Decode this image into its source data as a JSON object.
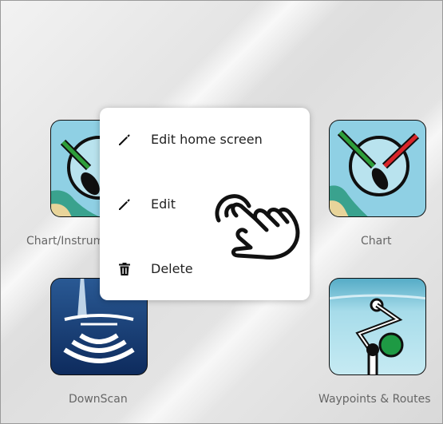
{
  "apps": [
    {
      "label": "Chart/Instruments",
      "icon": "chart-instruments-icon"
    },
    {
      "label": "Chart",
      "icon": "chart-icon"
    },
    {
      "label": "DownScan",
      "icon": "downscan-icon"
    },
    {
      "label": "Waypoints & Routes",
      "icon": "waypoints-routes-icon"
    }
  ],
  "context_menu": {
    "items": [
      {
        "label": "Edit home screen",
        "icon": "pencil-icon"
      },
      {
        "label": "Edit",
        "icon": "pencil-icon"
      },
      {
        "label": "Delete",
        "icon": "trash-icon"
      }
    ]
  },
  "overlay": {
    "icon": "tap-gesture-hand-icon"
  },
  "colors": {
    "tile_border": "#111111",
    "sea_light": "#9ed6e6",
    "sea_dark": "#143a6e",
    "chart_land": "#3aa28e",
    "compass_green": "#2e9e3a",
    "compass_red": "#d8262a",
    "route_green": "#1e9a44"
  }
}
